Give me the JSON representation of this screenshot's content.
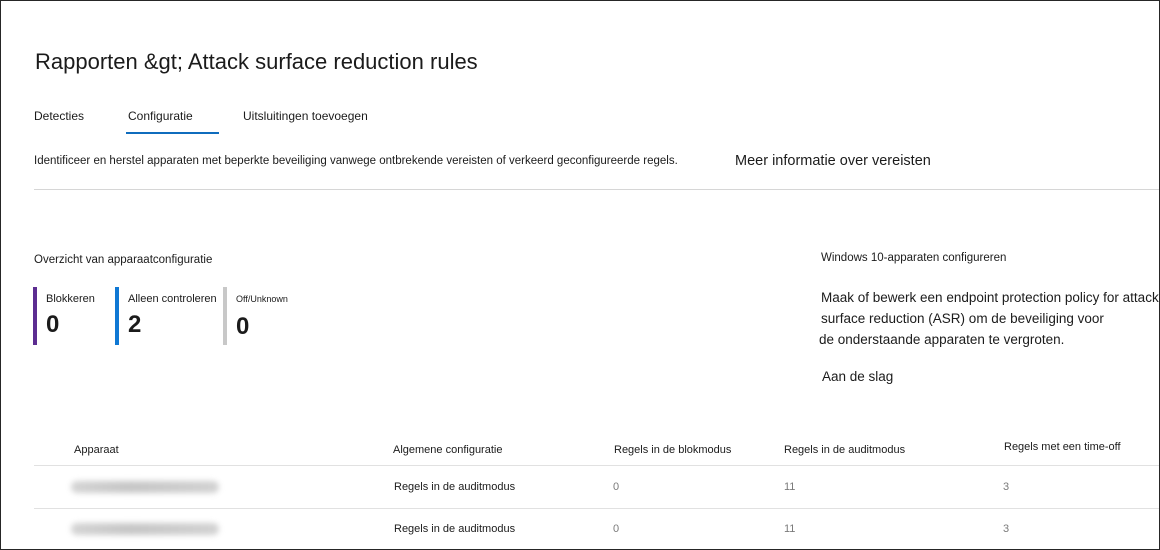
{
  "page": {
    "title": "Rapporten &gt; Attack surface reduction rules"
  },
  "tabs": [
    {
      "label": "Detecties"
    },
    {
      "label": "Configuratie",
      "active": true
    },
    {
      "label": "Uitsluitingen toevoegen"
    }
  ],
  "info": {
    "description": "Identificeer en herstel apparaten met beperkte beveiliging vanwege ontbrekende vereisten of verkeerd geconfigureerde regels.",
    "more_info_link": "Meer informatie over vereisten"
  },
  "overview": {
    "title": "Overzicht van apparaatconfiguratie",
    "stats": [
      {
        "label": "Blokkeren",
        "value": "0",
        "color": "#5c2d91"
      },
      {
        "label": "Alleen controleren",
        "value": "2",
        "color": "#0f78d4"
      },
      {
        "label": "Off/Unknown",
        "value": "0",
        "color": "#c8c8c8"
      }
    ]
  },
  "windows_panel": {
    "title": "Windows 10-apparaten configureren",
    "text_lines": [
      "Maak of bewerk een endpoint protection policy for attack",
      "surface reduction (ASR) om de beveiliging voor",
      "de onderstaande apparaten te vergroten."
    ],
    "link": "Aan de slag"
  },
  "table": {
    "columns": [
      "Apparaat",
      "Algemene configuratie",
      "Regels in de blokmodus",
      "Regels in de auditmodus",
      "Regels met een time-off"
    ],
    "rows": [
      {
        "device": "",
        "general": "Regels in de auditmodus",
        "block": "0",
        "audit": "11",
        "off": "3"
      },
      {
        "device": "",
        "general": "Regels in de auditmodus",
        "block": "0",
        "audit": "11",
        "off": "3"
      }
    ]
  },
  "colors": {
    "accent": "#0f6cbd",
    "block": "#5c2d91",
    "audit": "#0f78d4",
    "off": "#c8c8c8"
  }
}
